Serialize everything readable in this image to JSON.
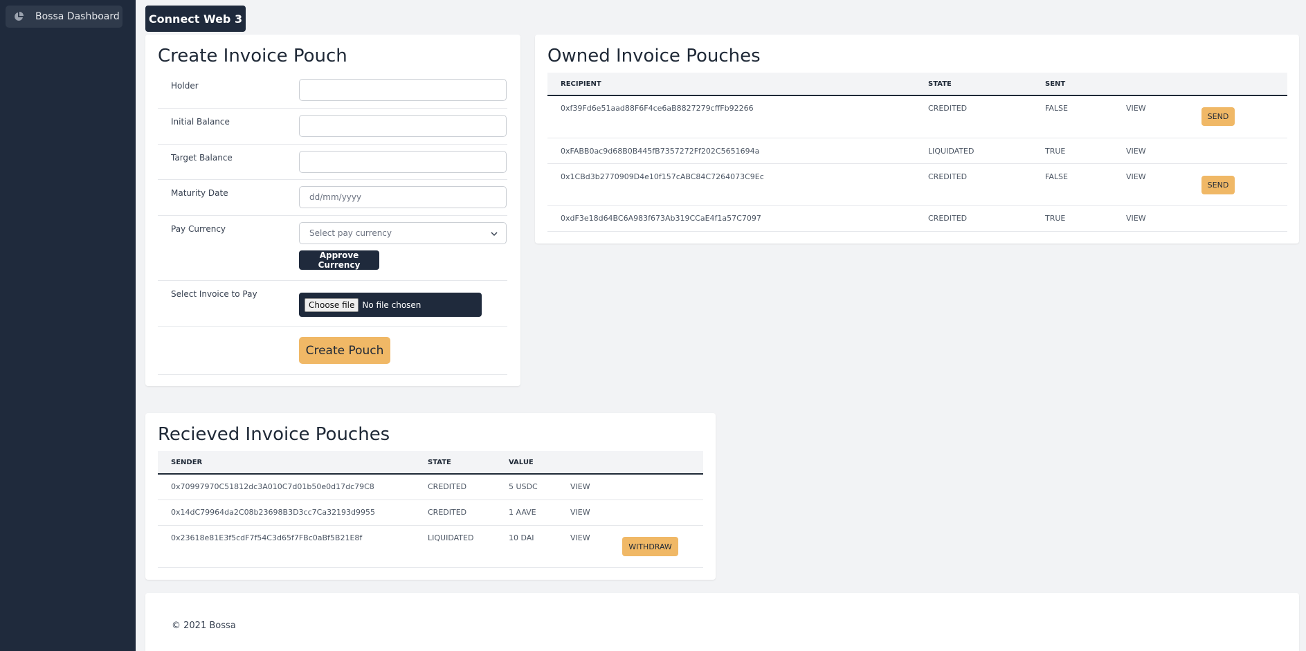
{
  "sidebar": {
    "items": [
      {
        "label": "Bossa Dashboard",
        "icon": "pie-chart-icon"
      }
    ]
  },
  "header": {
    "connect_label": "Connect Web 3"
  },
  "create_form": {
    "title": "Create Invoice Pouch",
    "fields": {
      "holder": {
        "label": "Holder",
        "value": ""
      },
      "initial_balance": {
        "label": "Initial Balance",
        "value": ""
      },
      "target_balance": {
        "label": "Target Balance",
        "value": ""
      },
      "maturity_date": {
        "label": "Maturity Date",
        "placeholder": "dd/mm/yyyy"
      },
      "pay_currency": {
        "label": "Pay Currency",
        "placeholder": "Select pay currency"
      },
      "invoice_file": {
        "label": "Select Invoice to Pay",
        "button": "Choose file",
        "status": "No file chosen"
      }
    },
    "approve_label": "Approve Currency",
    "submit_label": "Create Pouch"
  },
  "owned": {
    "title": "Owned Invoice Pouches",
    "columns": [
      "RECIPIENT",
      "STATE",
      "SENT"
    ],
    "rows": [
      {
        "recipient": "0xf39Fd6e51aad88F6F4ce6aB8827279cffFb92266",
        "state": "CREDITED",
        "sent": "FALSE",
        "view": "VIEW",
        "action": "SEND"
      },
      {
        "recipient": "0xFABB0ac9d68B0B445fB7357272Ff202C5651694a",
        "state": "LIQUIDATED",
        "sent": "TRUE",
        "view": "VIEW",
        "action": null
      },
      {
        "recipient": "0x1CBd3b2770909D4e10f157cABC84C7264073C9Ec",
        "state": "CREDITED",
        "sent": "FALSE",
        "view": "VIEW",
        "action": "SEND"
      },
      {
        "recipient": "0xdF3e18d64BC6A983f673Ab319CCaE4f1a57C7097",
        "state": "CREDITED",
        "sent": "TRUE",
        "view": "VIEW",
        "action": null
      }
    ]
  },
  "received": {
    "title": "Recieved Invoice Pouches",
    "columns": [
      "SENDER",
      "STATE",
      "VALUE"
    ],
    "rows": [
      {
        "sender": "0x70997970C51812dc3A010C7d01b50e0d17dc79C8",
        "state": "CREDITED",
        "value": "5 USDC",
        "view": "VIEW",
        "action": null
      },
      {
        "sender": "0x14dC79964da2C08b23698B3D3cc7Ca32193d9955",
        "state": "CREDITED",
        "value": "1 AAVE",
        "view": "VIEW",
        "action": null
      },
      {
        "sender": "0x23618e81E3f5cdF7f54C3d65f7FBc0aBf5B21E8f",
        "state": "LIQUIDATED",
        "value": "10 DAI",
        "view": "VIEW",
        "action": "WITHDRAW"
      }
    ]
  },
  "footer": {
    "text": "© 2021 Bossa"
  },
  "colors": {
    "sidebar": "#1f2a3c",
    "accent": "#f0b866",
    "background": "#f2f3f5"
  }
}
